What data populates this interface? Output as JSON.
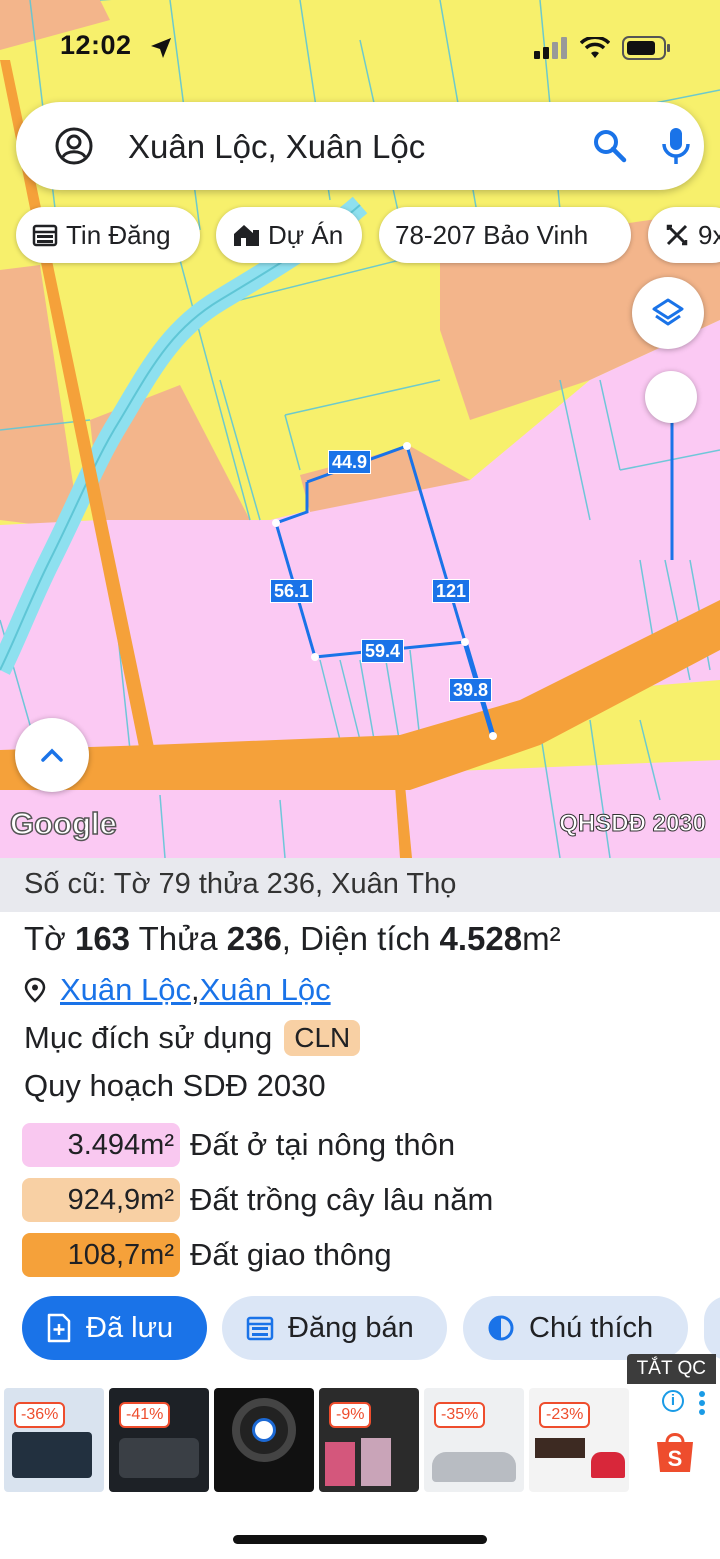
{
  "status": {
    "time": "12:02"
  },
  "search": {
    "query": "Xuân Lộc, Xuân Lộc"
  },
  "chips": [
    {
      "label": "Tin Đăng",
      "icon": "calendar-icon"
    },
    {
      "label": "Dự Án",
      "icon": "building-icon"
    },
    {
      "label": "78-207 Bảo Vinh",
      "icon": ""
    },
    {
      "label": "9x",
      "icon": "ruler-icon"
    }
  ],
  "map": {
    "dimensions": {
      "top": "44.9",
      "left": "56.1",
      "right": "121",
      "bottom": "59.4",
      "corner": "39.8"
    },
    "logo": "Google",
    "layer_label": "QHSDĐ 2030"
  },
  "parcel": {
    "old_ref": "Số cũ: Tờ 79 thửa 236, Xuân Thọ",
    "title_prefix": "Tờ ",
    "sheet": "163",
    "title_mid": " Thửa ",
    "plot": "236",
    "title_area_prefix": ", Diện tích ",
    "area": "4.528",
    "area_unit": "m²",
    "location_a": "Xuân Lộc",
    "location_sep": ", ",
    "location_b": "Xuân Lộc",
    "purpose_label": "Mục đích sử dụng",
    "purpose_code": "CLN",
    "plan_label": "Quy hoạch SDĐ 2030",
    "zones": [
      {
        "value": "3.494m²",
        "label": "Đất ở tại nông thôn",
        "color": "#f9c8f0"
      },
      {
        "value": "924,9m²",
        "label": "Đất trồng cây lâu năm",
        "color": "#f8d0a4"
      },
      {
        "value": "108,7m²",
        "label": "Đất giao thông",
        "color": "#f5a13a"
      }
    ]
  },
  "actions": [
    {
      "label": "Đã lưu",
      "icon": "bookmark-add-icon",
      "primary": true
    },
    {
      "label": "Đăng bán",
      "icon": "calendar-icon",
      "primary": false
    },
    {
      "label": "Chú thích",
      "icon": "contrast-icon",
      "primary": false
    }
  ],
  "ads": {
    "close_label": "TẮT QC",
    "discounts": [
      "-36%",
      "-41%",
      "",
      "-9%",
      "-35%",
      "-23%"
    ]
  }
}
